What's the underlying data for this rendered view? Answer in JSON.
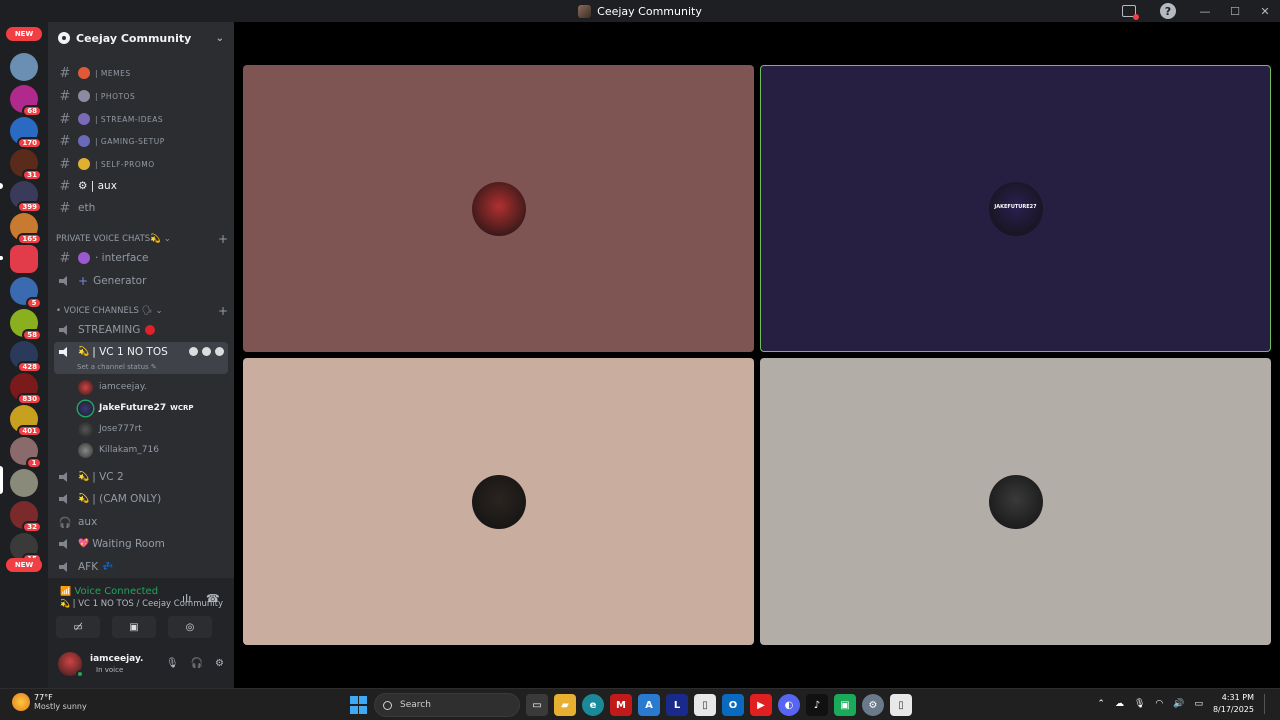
{
  "window": {
    "title": "Ceejay Community"
  },
  "rail": {
    "new_top": "NEW",
    "new_bottom": "NEW",
    "servers": [
      {
        "badge": "",
        "color": "#6b8fb3"
      },
      {
        "badge": "68",
        "color": "#b02a8e"
      },
      {
        "badge": "170",
        "color": "#2a6ac2"
      },
      {
        "badge": "31",
        "color": "#5a2a1a"
      },
      {
        "badge": "399",
        "color": "#3a3a5a"
      },
      {
        "badge": "165",
        "color": "#c87a30"
      },
      {
        "badge": "",
        "color": "#e23b4a"
      },
      {
        "badge": "5",
        "color": "#3a6ab0"
      },
      {
        "badge": "58",
        "color": "#8ab020"
      },
      {
        "badge": "428",
        "color": "#2a3a5a"
      },
      {
        "badge": "830",
        "color": "#7a1a1a"
      },
      {
        "badge": "401",
        "color": "#c8a020"
      },
      {
        "badge": "1",
        "color": "#8a6a6a"
      },
      {
        "badge": "",
        "color": "#8a8a7a"
      },
      {
        "badge": "32",
        "color": "#7a2a2a"
      },
      {
        "badge": "15",
        "color": "#3a3a3a"
      }
    ]
  },
  "sidebar": {
    "server_name": "Ceejay Community",
    "text_channels": [
      {
        "label": "| memes",
        "emoji_color": "#e05a3a"
      },
      {
        "label": "| photos",
        "emoji_color": "#8a8aa0"
      },
      {
        "label": "| stream-ideas",
        "emoji_color": "#7a6ab8"
      },
      {
        "label": "| gaming-setup",
        "emoji_color": "#6a6ab8"
      },
      {
        "label": "| self-promo",
        "emoji_color": "#e0b030"
      }
    ],
    "aux_channel": "⚙ | aux",
    "eth_channel": "eth",
    "private_category": "PRIVATE VOICE CHATS💫",
    "interface_channel": "· interface",
    "generator_channel": "Generator",
    "voice_category": "• VOICE CHANNELS 🗣",
    "streaming_channel": "STREAMING",
    "active_vc": "| VC 1 NO TOS",
    "active_vc_status": "Set a channel status",
    "members": [
      {
        "name": "iamceejay.",
        "bold": false,
        "tag": ""
      },
      {
        "name": "JakeFuture27",
        "bold": true,
        "tag": "WCRP"
      },
      {
        "name": "Jose777rt",
        "bold": false,
        "tag": ""
      },
      {
        "name": "Killakam_716",
        "bold": false,
        "tag": ""
      }
    ],
    "other_vcs": [
      "| VC 2",
      "| (CAM ONLY)",
      "aux",
      "Waiting Room",
      "AFK"
    ]
  },
  "voice_panel": {
    "status": "Voice Connected",
    "location": "| VC 1 NO TOS / Ceejay Community"
  },
  "user": {
    "name": "iamceejay.",
    "status": "In voice"
  },
  "stage": {
    "tiles": [
      {
        "bg": "#7f5553",
        "avatar": "#b03030"
      },
      {
        "bg": "#271f42",
        "avatar": "#2a2050",
        "label": "JAKEFUTURE27",
        "highlight": true
      },
      {
        "bg": "#c9aea0",
        "avatar": "#2a2420"
      },
      {
        "bg": "#b3ada8",
        "avatar": "#3a3a3a"
      }
    ]
  },
  "taskbar": {
    "temp": "77°F",
    "weather": "Mostly sunny",
    "search_placeholder": "Search",
    "time": "4:31 PM",
    "date": "8/17/2025"
  }
}
